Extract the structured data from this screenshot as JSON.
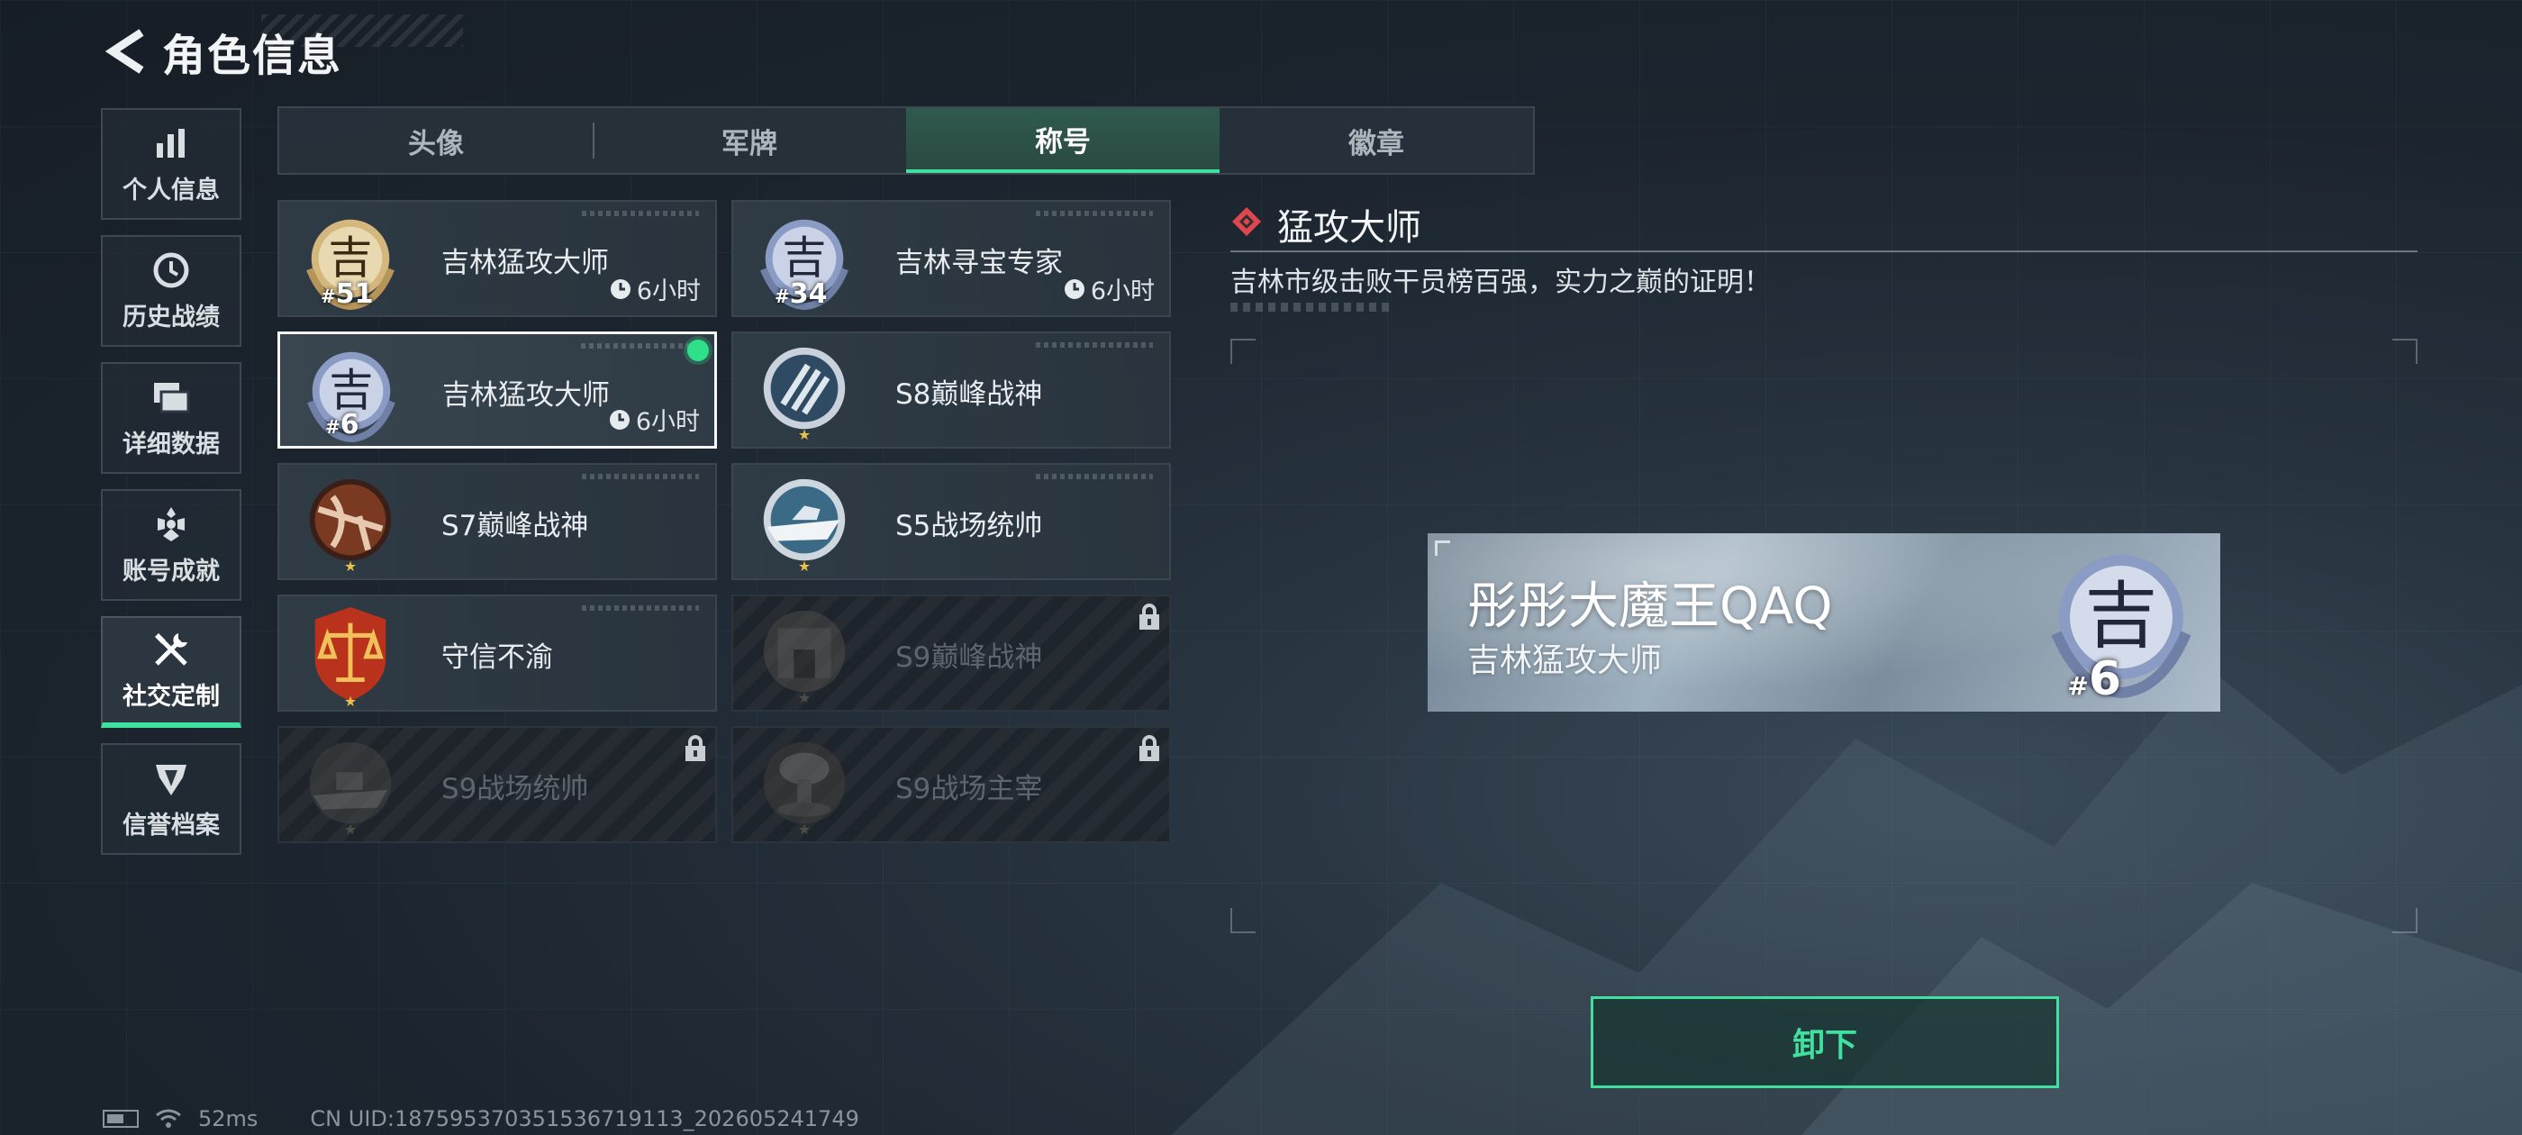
{
  "header": {
    "title": "角色信息"
  },
  "sidebar": {
    "items": [
      {
        "label": "个人信息",
        "icon": "bar-chart-icon",
        "active": false
      },
      {
        "label": "历史战绩",
        "icon": "history-clock-icon",
        "active": false
      },
      {
        "label": "详细数据",
        "icon": "folders-icon",
        "active": false
      },
      {
        "label": "账号成就",
        "icon": "achievement-icon",
        "active": false
      },
      {
        "label": "社交定制",
        "icon": "tools-icon",
        "active": true
      },
      {
        "label": "信誉档案",
        "icon": "credit-shield-icon",
        "active": false
      }
    ]
  },
  "tabs": [
    {
      "label": "头像",
      "active": false
    },
    {
      "label": "军牌",
      "active": false
    },
    {
      "label": "称号",
      "active": true
    },
    {
      "label": "徽章",
      "active": false
    }
  ],
  "titles": [
    {
      "name": "吉林猛攻大师",
      "rank_hash": "#",
      "rank_num": "51",
      "timer": "6小时",
      "medal": "gold-ji-medal-icon",
      "selected": false,
      "locked": false
    },
    {
      "name": "吉林寻宝专家",
      "rank_hash": "#",
      "rank_num": "34",
      "timer": "6小时",
      "medal": "silver-ji-medal-icon",
      "selected": false,
      "locked": false
    },
    {
      "name": "吉林猛攻大师",
      "rank_hash": "#",
      "rank_num": "6",
      "timer": "6小时",
      "medal": "silver-ji-medal-icon",
      "selected": true,
      "locked": false
    },
    {
      "name": "S8巅峰战神",
      "rank_hash": "",
      "rank_num": "",
      "timer": "",
      "medal": "s8-emblem-icon",
      "selected": false,
      "locked": false
    },
    {
      "name": "S7巅峰战神",
      "rank_hash": "",
      "rank_num": "",
      "timer": "",
      "medal": "s7-crossbow-emblem-icon",
      "selected": false,
      "locked": false
    },
    {
      "name": "S5战场统帅",
      "rank_hash": "",
      "rank_num": "",
      "timer": "",
      "medal": "s5-boat-emblem-icon",
      "selected": false,
      "locked": false
    },
    {
      "name": "守信不渝",
      "rank_hash": "",
      "rank_num": "",
      "timer": "",
      "medal": "scales-emblem-icon",
      "selected": false,
      "locked": false
    },
    {
      "name": "S9巅峰战神",
      "rank_hash": "",
      "rank_num": "",
      "timer": "",
      "medal": "s9-gate-emblem-icon",
      "selected": false,
      "locked": true
    },
    {
      "name": "S9战场统帅",
      "rank_hash": "",
      "rank_num": "",
      "timer": "",
      "medal": "s9-ship-emblem-icon",
      "selected": false,
      "locked": true
    },
    {
      "name": "S9战场主宰",
      "rank_hash": "",
      "rank_num": "",
      "timer": "",
      "medal": "s9-explosion-emblem-icon",
      "selected": false,
      "locked": true
    }
  ],
  "detail": {
    "title": "猛攻大师",
    "description": "吉林市级击败干员榜百强，实力之巅的证明！"
  },
  "namecard": {
    "player_name": "彤彤大魔王QAQ",
    "title": "吉林猛攻大师",
    "rank_hash": "#",
    "rank_num": "6"
  },
  "actions": {
    "unequip_label": "卸下"
  },
  "status_bar": {
    "ping": "52ms",
    "uid": "CN UID:187595370351536719113_202605241749"
  },
  "colors": {
    "accent": "#3fe0a0",
    "selected_dot": "#2fe08a",
    "detail_icon": "#e0474c"
  }
}
